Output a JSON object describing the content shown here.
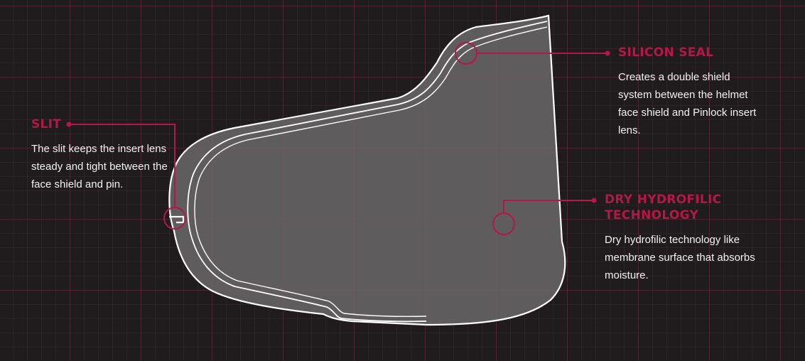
{
  "colors": {
    "accent": "#b31848",
    "background": "#201c1e",
    "lens_fill": "#6d6a6b",
    "outline": "#ffffff"
  },
  "callouts": {
    "slit": {
      "title": "SLIT",
      "description": "The slit keeps the insert lens steady and tight between the face shield and pin."
    },
    "silicon_seal": {
      "title": "SILICON SEAL",
      "description": "Creates a double shield system between the helmet face shield and Pinlock insert lens."
    },
    "dry_hydrofilic": {
      "title": "DRY HYDROFILIC TECHNOLOGY",
      "description": "Dry hydrofilic technology like membrane surface that absorbs moisture."
    }
  }
}
